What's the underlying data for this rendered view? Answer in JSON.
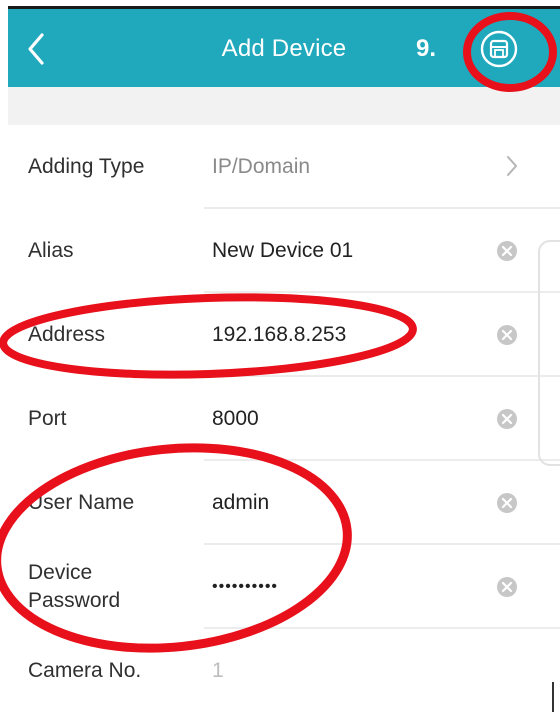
{
  "header": {
    "title": "Add Device",
    "step": "9.",
    "background": "#20a9bc",
    "back_icon": "chevron-left-icon",
    "save_icon": "save-disk-icon"
  },
  "form": {
    "rows": [
      {
        "label": "Adding Type",
        "value": "IP/Domain",
        "control": "chevron-right-icon"
      },
      {
        "label": "Alias",
        "value": "New Device 01",
        "control": "clear-icon"
      },
      {
        "label": "Address",
        "value": "192.168.8.253",
        "control": "clear-icon"
      },
      {
        "label": "Port",
        "value": "8000",
        "control": "clear-icon"
      },
      {
        "label": "User Name",
        "value": "admin",
        "control": "clear-icon"
      },
      {
        "label": "Device Password",
        "value": "••••••••••",
        "control": "clear-icon"
      },
      {
        "label": "Camera No.",
        "value": "1"
      }
    ]
  },
  "annotation_color": "#e8101a"
}
